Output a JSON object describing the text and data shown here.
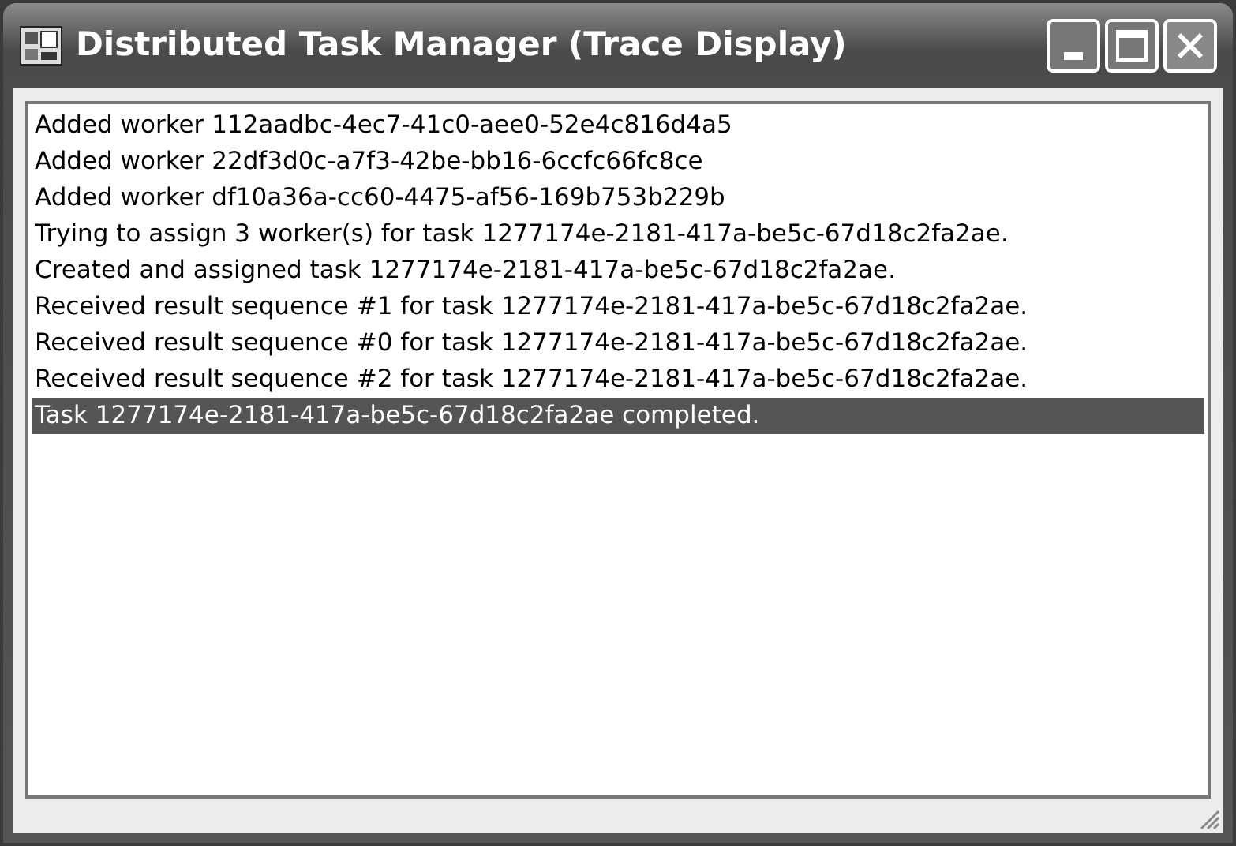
{
  "window": {
    "title": "Distributed Task Manager (Trace Display)"
  },
  "trace_list": [
    {
      "text": "Added worker 112aadbc-4ec7-41c0-aee0-52e4c816d4a5",
      "selected": false
    },
    {
      "text": "Added worker 22df3d0c-a7f3-42be-bb16-6ccfc66fc8ce",
      "selected": false
    },
    {
      "text": "Added worker df10a36a-cc60-4475-af56-169b753b229b",
      "selected": false
    },
    {
      "text": "Trying to assign 3 worker(s) for task 1277174e-2181-417a-be5c-67d18c2fa2ae.",
      "selected": false
    },
    {
      "text": "Created and assigned task 1277174e-2181-417a-be5c-67d18c2fa2ae.",
      "selected": false
    },
    {
      "text": "Received result sequence #1 for task 1277174e-2181-417a-be5c-67d18c2fa2ae.",
      "selected": false
    },
    {
      "text": "Received result sequence #0 for task 1277174e-2181-417a-be5c-67d18c2fa2ae.",
      "selected": false
    },
    {
      "text": "Received result sequence #2 for task 1277174e-2181-417a-be5c-67d18c2fa2ae.",
      "selected": false
    },
    {
      "text": "Task 1277174e-2181-417a-be5c-67d18c2fa2ae completed.",
      "selected": true
    }
  ]
}
